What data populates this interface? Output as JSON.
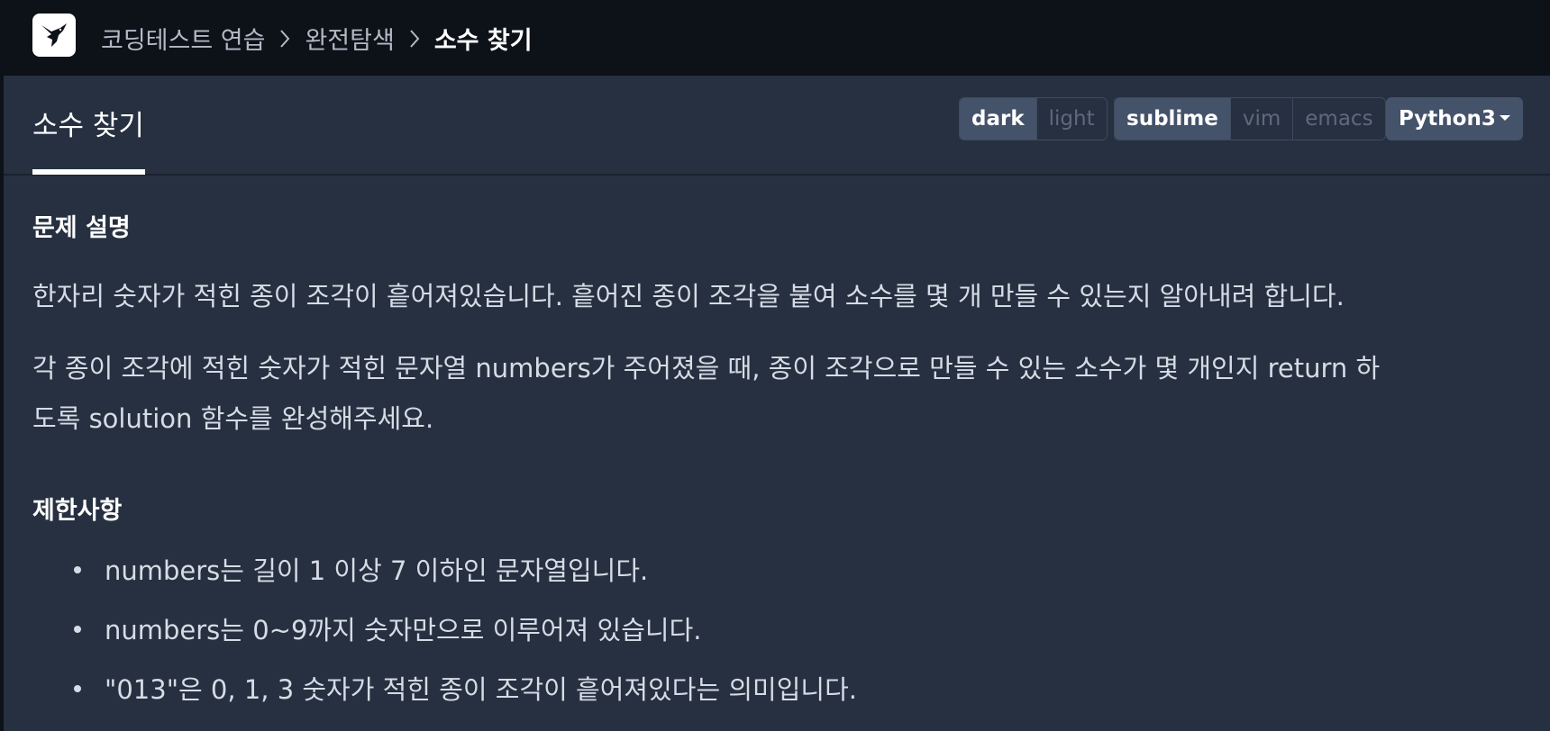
{
  "header": {
    "logo_icon": "hummingbird-logo-icon",
    "breadcrumb": [
      {
        "label": "코딩테스트 연습"
      },
      {
        "label": "완전탐색"
      },
      {
        "label": "소수 찾기"
      }
    ]
  },
  "tabbar": {
    "title": "소수 찾기",
    "theme_options": [
      "dark",
      "light"
    ],
    "theme_selected": "dark",
    "keymap_options": [
      "sublime",
      "vim",
      "emacs"
    ],
    "keymap_selected": "sublime",
    "language_selected": "Python3"
  },
  "problem": {
    "description_heading": "문제 설명",
    "description_line1": "한자리 숫자가 적힌 종이 조각이 흩어져있습니다. 흩어진 종이 조각을 붙여 소수를 몇 개 만들 수 있는지 알아내려 합니다.",
    "description_line2a": "각 종이 조각에 적힌 숫자가 적힌 문자열 numbers가 주어졌을 때, 종이 조각으로 만들 수 있는 소수가 몇 개인지 return 하",
    "description_line2b": "도록 solution 함수를 완성해주세요.",
    "constraints_heading": "제한사항",
    "constraints": [
      "numbers는 길이 1 이상 7 이하인 문자열입니다.",
      "numbers는 0~9까지 숫자만으로 이루어져 있습니다.",
      "\"013\"은 0, 1, 3 숫자가 적힌 종이 조각이 흩어져있다는 의미입니다."
    ]
  },
  "colors": {
    "topbar_bg": "#0d1118",
    "panel_bg": "#263040",
    "active_button_bg": "#44526a",
    "text_primary": "#ffffff",
    "text_body": "#d6dce5",
    "text_muted": "#5e6a7c"
  }
}
